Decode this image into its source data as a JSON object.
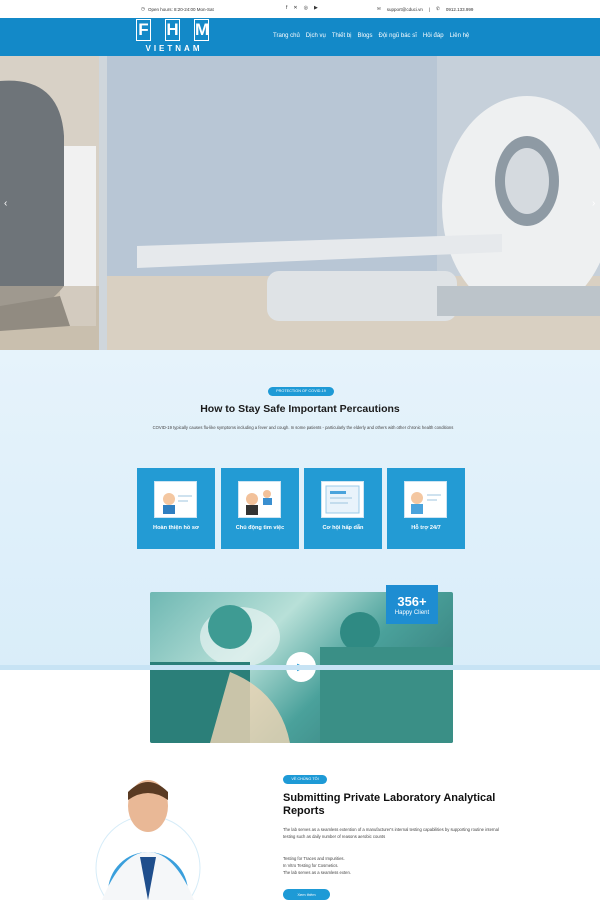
{
  "topbar": {
    "hours": "Open hours: 8:20-24:00 Mon-Sat",
    "email": "support@cduci.vn",
    "separator": "|",
    "phone": "0912.133.999"
  },
  "logo": {
    "letters": [
      "F",
      "H",
      "M"
    ],
    "tagline": "VIETNAM"
  },
  "menu": [
    "Trang chủ",
    "Dịch vụ",
    "Thiết bị",
    "Blogs",
    "Đội ngũ bác sĩ",
    "Hỏi đáp",
    "Liên hệ"
  ],
  "hero": {
    "prev": "‹",
    "next": "›"
  },
  "safety": {
    "tag": "PROTECTION OF COVID-19",
    "title": "How to Stay Safe Important Percautions",
    "description": "COVID-19 typically causes flu-like symptoms including a fever and cough. In some patients - particularly the elderly and others with other chronic health conditions"
  },
  "cards": [
    {
      "label": "Hoàn thiện hồ sơ"
    },
    {
      "label": "Chủ động tìm việc"
    },
    {
      "label": "Cơ hội hấp dẫn"
    },
    {
      "label": "Hỗ trợ 24/7"
    }
  ],
  "stat": {
    "value": "356+",
    "label": "Happy Client"
  },
  "about": {
    "tag": "VỀ CHÚNG TÔI",
    "title": "Submitting Private Laboratory Analytical Reports",
    "paragraph": "The lab serves as a seamless extention of a manufacturer's internal testing capabilities by supporting routine internal testing such as daily number of reasons aerobic counts",
    "line1": "Testing for Traces and Impurities.",
    "line2": "In Vitro Testing for Cosmetics.",
    "line3": "The lab serves as a seamless exten.",
    "button": "Xem thêm"
  },
  "colors": {
    "brand": "#1389c8",
    "accent": "#1e9ad6",
    "card": "#239bd4"
  }
}
